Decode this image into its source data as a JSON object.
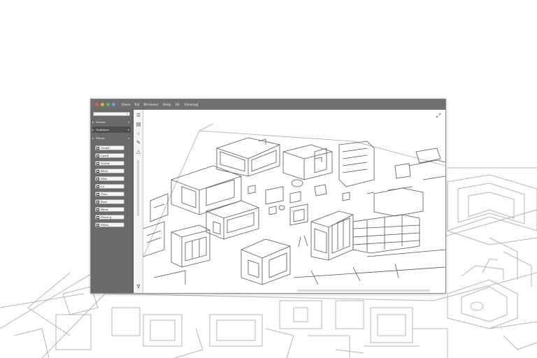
{
  "window": {
    "menu": [
      "Docs",
      "Ed",
      "Browser",
      "Help",
      "Ht",
      "Viewing"
    ],
    "traffic_colors": [
      "#e5534b",
      "#e9b132",
      "#5cb85c",
      "#6aa0d8"
    ]
  },
  "sidebar": {
    "search_placeholder": "",
    "search_icon": "search-icon",
    "sections": [
      {
        "label": "Viewer",
        "icon": "folder-icon"
      },
      {
        "label": "Guidance",
        "icon": "folder-icon"
      },
      {
        "label": "Planer",
        "icon": "folder-icon"
      }
    ],
    "items": [
      "Cioud",
      "Lavid",
      "Voctor",
      "Elvet",
      "Fata",
      "Lo",
      "Tvss",
      "Fave",
      "Bleor",
      "Feore g",
      "Eelsa"
    ]
  },
  "toolbar": {
    "tools": [
      "layers-icon",
      "ruler-icon",
      "pan-icon",
      "pencil-icon",
      "measure-icon"
    ],
    "bottom_tool": "settings-icon"
  },
  "viewport": {
    "content": "isometric-city-plan-drawing",
    "expand_icon": "expand-icon"
  }
}
